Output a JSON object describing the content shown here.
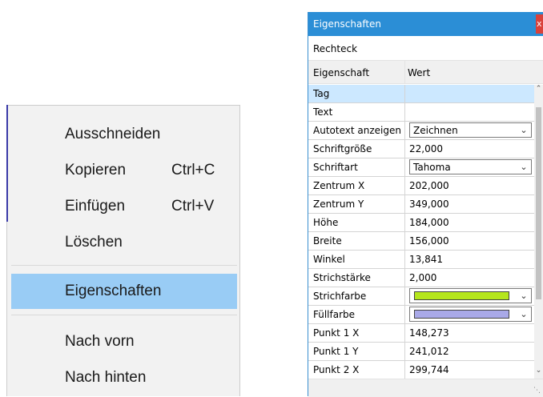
{
  "context_menu": {
    "items": [
      {
        "label": "Ausschneiden",
        "shortcut": ""
      },
      {
        "label": "Kopieren",
        "shortcut": "Ctrl+C"
      },
      {
        "label": "Einfügen",
        "shortcut": "Ctrl+V"
      },
      {
        "label": "Löschen",
        "shortcut": ""
      },
      {
        "label": "Eigenschaften",
        "shortcut": ""
      },
      {
        "label": "Nach vorn",
        "shortcut": ""
      },
      {
        "label": "Nach hinten",
        "shortcut": ""
      }
    ],
    "highlighted": "Eigenschaften"
  },
  "properties_window": {
    "title": "Eigenschaften",
    "close_label": "x",
    "object_name": "Rechteck",
    "columns": [
      "Eigenschaft",
      "Wert"
    ],
    "rows": [
      {
        "key": "Tag",
        "value": "",
        "selected": true
      },
      {
        "key": "Text",
        "value": ""
      },
      {
        "key": "Autotext anzeigen",
        "value": "Zeichnen",
        "type": "dropdown"
      },
      {
        "key": "Schriftgröße",
        "value": "22,000"
      },
      {
        "key": "Schriftart",
        "value": "Tahoma",
        "type": "dropdown"
      },
      {
        "key": "Zentrum X",
        "value": "202,000"
      },
      {
        "key": "Zentrum Y",
        "value": "349,000"
      },
      {
        "key": "Höhe",
        "value": "184,000"
      },
      {
        "key": "Breite",
        "value": "156,000"
      },
      {
        "key": "Winkel",
        "value": "13,841"
      },
      {
        "key": "Strichstärke",
        "value": "2,000"
      },
      {
        "key": "Strichfarbe",
        "value": "",
        "type": "color-dropdown",
        "color": "#b5e61d"
      },
      {
        "key": "Füllfarbe",
        "value": "",
        "type": "color-dropdown",
        "color": "#a9a9e8"
      },
      {
        "key": "Punkt 1 X",
        "value": "148,273"
      },
      {
        "key": "Punkt 1 Y",
        "value": "241,012"
      },
      {
        "key": "Punkt 2 X",
        "value": "299,744"
      }
    ]
  },
  "colors": {
    "titlebar": "#2b8ed6",
    "menu_highlight": "#99ccf5",
    "row_selected": "#cce8ff",
    "close_button": "#d9413b"
  }
}
